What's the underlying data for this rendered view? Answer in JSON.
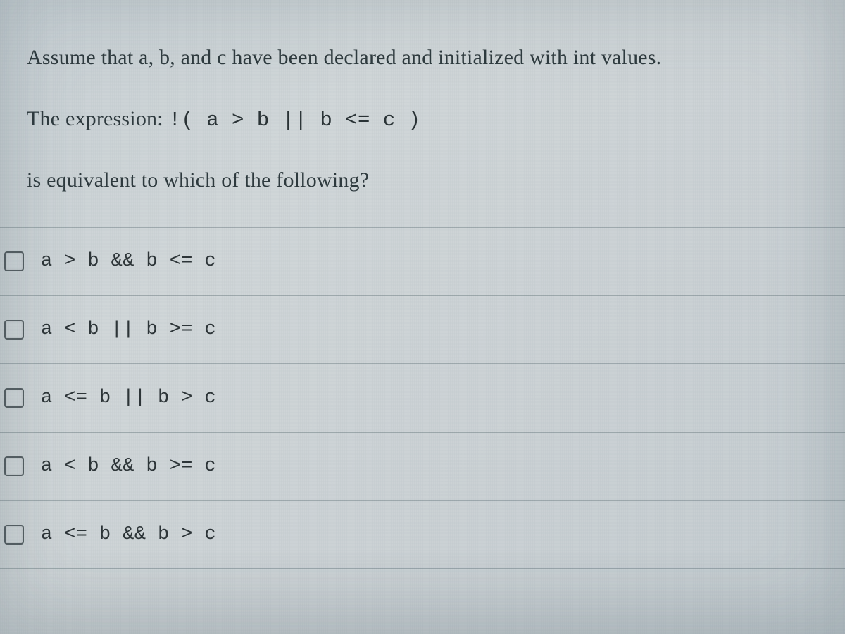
{
  "question": {
    "line1": "Assume that a, b, and c have been declared and initialized with int values.",
    "line2_prefix": "The expression:  ",
    "line2_code": "!( a > b  || b <= c )",
    "line3": "is equivalent to which of the following?"
  },
  "options": [
    {
      "label": "a > b && b <= c",
      "checked": false
    },
    {
      "label": "a < b || b >= c",
      "checked": false
    },
    {
      "label": "a <= b || b > c",
      "checked": false
    },
    {
      "label": "a < b && b >= c",
      "checked": false
    },
    {
      "label": "a <= b && b > c",
      "checked": false
    }
  ]
}
